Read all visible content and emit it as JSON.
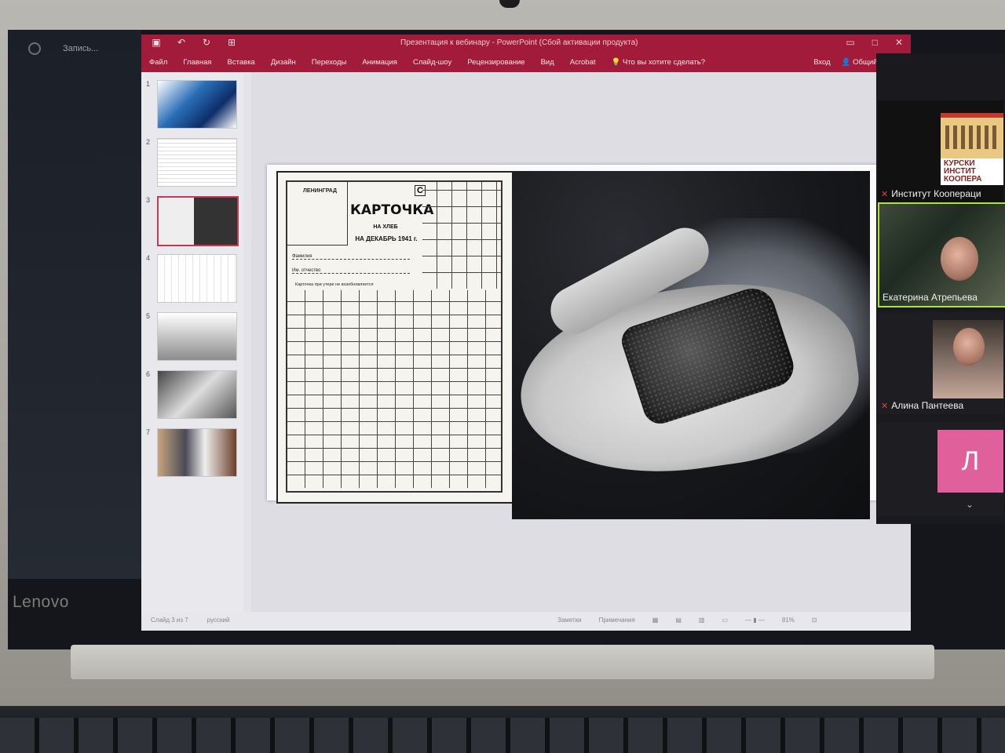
{
  "device": {
    "brand": "Lenovo"
  },
  "zoom": {
    "recording_label": "Запись...",
    "participants": [
      {
        "name": "Институт Коопераци",
        "logo_text": [
          "КУРСКИ",
          "ИНСТИТ",
          "КООПЕРА"
        ]
      },
      {
        "name": "Екатерина Атрепьева"
      },
      {
        "name": "Алина Пантеева"
      },
      {
        "initial": "Л"
      }
    ]
  },
  "powerpoint": {
    "title": "Презентация к вебинару - PowerPoint (Сбой активации продукта)",
    "qat_icons": [
      "save-icon",
      "undo-icon",
      "redo-icon",
      "present-icon"
    ],
    "tabs": [
      "Файл",
      "Главная",
      "Вставка",
      "Дизайн",
      "Переходы",
      "Анимация",
      "Слайд-шоу",
      "Рецензирование",
      "Вид",
      "Acrobat"
    ],
    "tell_me": "Что вы хотите сделать?",
    "sign_in": "Вход",
    "share": "Общий доступ",
    "thumbnails": [
      "1",
      "2",
      "3",
      "4",
      "5",
      "6",
      "7"
    ],
    "selected_slide": 3,
    "status": {
      "slide_counter": "Слайд 3 из 7",
      "language": "русский",
      "notes": "Заметки",
      "comments": "Примечания",
      "zoom": "81%"
    }
  },
  "slide": {
    "card": {
      "city": "ЛЕНИНГРАД",
      "letter": "С",
      "title": "КАРТОЧКА",
      "line1": "НА ХЛЕБ",
      "line2": "НА ДЕКАБРЬ 1941 г.",
      "field1": "Фамилия",
      "field2": "Им. отчество",
      "note": "Карточка при утере не возобновляется"
    }
  }
}
